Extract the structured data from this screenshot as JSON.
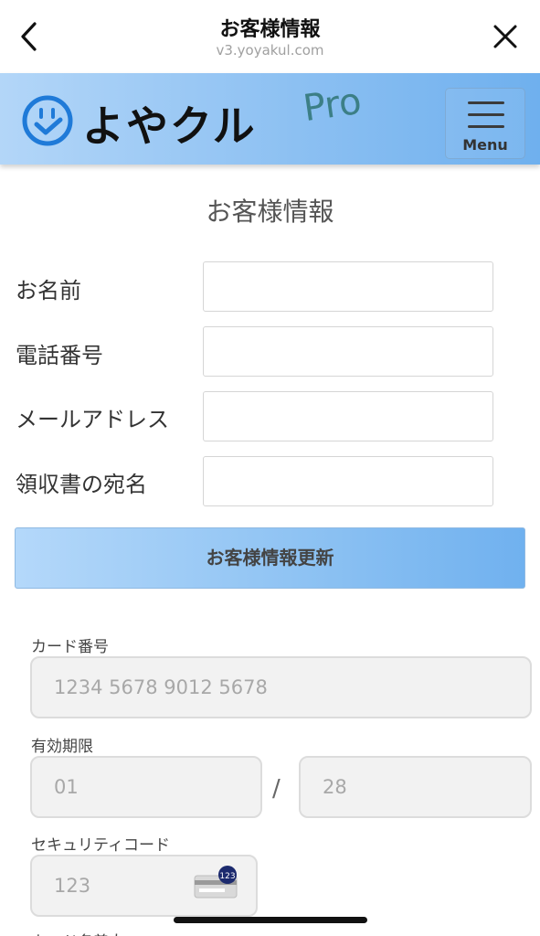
{
  "browser": {
    "title": "お客様情報",
    "url": "v3.yoyakul.com"
  },
  "header": {
    "logo_text": "よやクル",
    "logo_pro": "Pro",
    "menu_label": "Menu",
    "colors": {
      "gradient_start": "#b3d6f8",
      "gradient_end": "#6fb0ee"
    }
  },
  "form": {
    "title": "お客様情報",
    "fields": [
      {
        "label": "お名前",
        "value": ""
      },
      {
        "label": "電話番号",
        "value": ""
      },
      {
        "label": "メールアドレス",
        "value": ""
      },
      {
        "label": "領収書の宛名",
        "value": ""
      }
    ],
    "submit_label": "お客様情報更新"
  },
  "payment": {
    "card_number_label": "カード番号",
    "card_number_placeholder": "1234 5678 9012 5678",
    "expiry_label": "有効期限",
    "expiry_month_placeholder": "01",
    "expiry_separator": "/",
    "expiry_year_placeholder": "28",
    "cvc_label": "セキュリティコード",
    "cvc_placeholder": "123",
    "cvc_icon_badge": "123",
    "next_label_partial": "カード名義人"
  }
}
